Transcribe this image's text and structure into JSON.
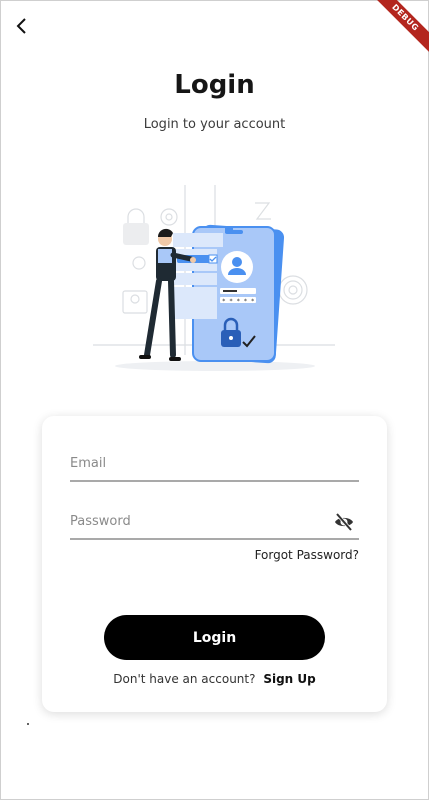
{
  "header": {
    "back_icon": "chevron-left-icon",
    "debug_banner": "DEBUG",
    "title": "Login",
    "subtitle": "Login to your account"
  },
  "illustration": {
    "name": "login-security-illustration",
    "phone_mask_text": "* * * * *"
  },
  "form": {
    "email": {
      "placeholder": "Email",
      "value": ""
    },
    "password": {
      "placeholder": "Password",
      "value": "",
      "toggle_icon": "eye-off-icon"
    },
    "forgot_label": "Forgot Password?",
    "login_label": "Login",
    "signup_prompt": "Don't have an account?",
    "signup_label": "Sign Up"
  },
  "colors": {
    "primary_button": "#000000",
    "accent_blue": "#4a90f0",
    "debug_red": "#b3261e"
  }
}
